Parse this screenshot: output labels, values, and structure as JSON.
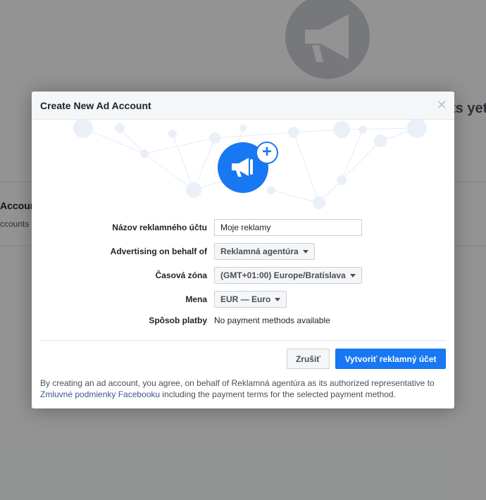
{
  "background": {
    "heading_partial": "ts yet",
    "left_title_partial": "Account",
    "left_sub_partial": "ccounts"
  },
  "modal": {
    "title": "Create New Ad Account",
    "close_icon": "close-icon",
    "hero_icon": "megaphone-icon",
    "hero_badge": "+",
    "fields": {
      "account_name_label": "Názov reklamného účtu",
      "account_name_value": "Moje reklamy",
      "behalf_label": "Advertising on behalf of",
      "behalf_value": "Reklamná agentúra",
      "timezone_label": "Časová zóna",
      "timezone_value": "(GMT+01:00) Europe/Bratislava",
      "currency_label": "Mena",
      "currency_value": "EUR — Euro",
      "payment_label": "Spôsob platby",
      "payment_value": "No payment methods available"
    },
    "buttons": {
      "cancel": "Zrušiť",
      "create": "Vytvoriť reklamný účet"
    },
    "legal": {
      "text_before": "By creating an ad account, you agree, on behalf of Reklamná agentúra as its authorized representative to ",
      "link": "Zmluvné podmienky Facebooku",
      "text_after": " including the payment terms for the selected payment method."
    }
  },
  "colors": {
    "primary": "#1877f2",
    "overlay": "rgba(0,0,0,0.4)"
  }
}
